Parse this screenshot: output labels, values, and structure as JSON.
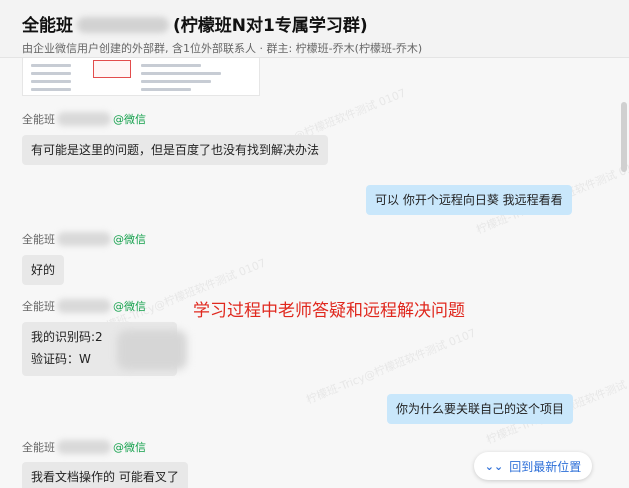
{
  "header": {
    "title_prefix": "全能班",
    "title_suffix": "(柠檬班N对1专属学习群)",
    "subtitle": "由企业微信用户创建的外部群, 含1位外部联系人 · 群主: 柠檬班-乔木(柠檬班-乔木)"
  },
  "messages": [
    {
      "sender_prefix": "全能班",
      "sender_suffix": "@微信",
      "text": "有可能是这里的问题，但是百度了也没有找到解决办法"
    },
    {
      "text": "可以 你开个远程向日葵 我远程看看"
    },
    {
      "sender_prefix": "全能班",
      "sender_suffix": "@微信",
      "text": "好的"
    },
    {
      "sender_prefix": "全能班",
      "sender_suffix": "@微信",
      "line1": "我的识别码:2",
      "line2": "验证码：W"
    },
    {
      "text": "你为什么要关联自己的这个项目"
    },
    {
      "sender_prefix": "全能班",
      "sender_suffix": "@微信",
      "text": "我看文档操作的 可能看叉了"
    }
  ],
  "annotation": "学习过程中老师答疑和远程解决问题",
  "latest_button": {
    "icon": "double-chevron-down-icon",
    "label": "回到最新位置"
  },
  "watermark": "柠檬班-Tricy@柠檬班软件测试 0107",
  "colors": {
    "incoming_bubble": "#e8e8e8",
    "outgoing_bubble": "#c9e7fb",
    "wechat_green": "#13a04b",
    "annotation_red": "#e0281e",
    "link_blue": "#2d6fd8"
  }
}
